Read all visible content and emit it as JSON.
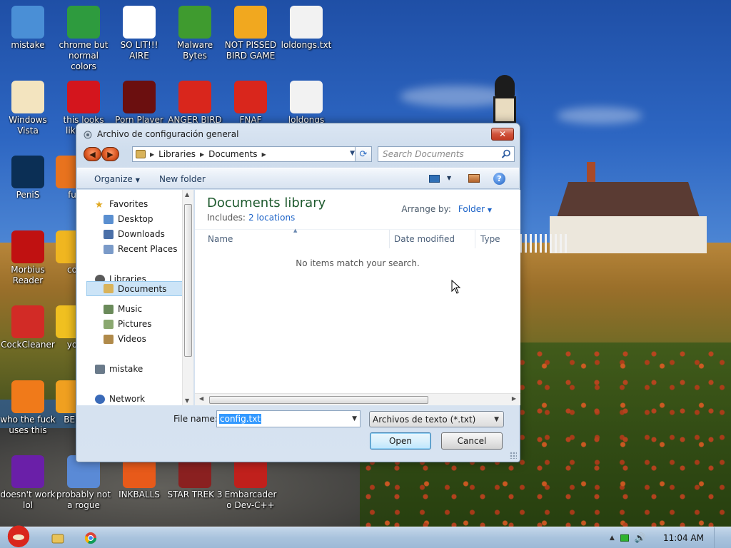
{
  "desktop": {
    "icons": [
      {
        "label": "mistake",
        "icon": "computer-icon",
        "color": "#4a8fd6"
      },
      {
        "label": "chrome but normal colors",
        "icon": "chrome-icon",
        "color": "#2e9b3e"
      },
      {
        "label": "SO LIT!!! AIRE",
        "icon": "cards-icon",
        "color": "#ffffff"
      },
      {
        "label": "Malware Bytes",
        "icon": "shield-icon",
        "color": "#3f9b2f"
      },
      {
        "label": "NOT PISSED BIRD GAME",
        "icon": "green-pig-icon",
        "color": "#f1a81f"
      },
      {
        "label": "loldongs.txt",
        "icon": "text-file-icon",
        "color": "#f2f2f2"
      },
      {
        "label": "Windows Vista",
        "icon": "egg-icon",
        "color": "#f3e4bf"
      },
      {
        "label": "this looks like a va",
        "icon": "opera-icon",
        "color": "#d4151d"
      },
      {
        "label": "Porn Player",
        "icon": "flash-icon",
        "color": "#6b0f0f"
      },
      {
        "label": "ANGER BIRD",
        "icon": "red-bird-icon",
        "color": "#d9261c"
      },
      {
        "label": "FNAF",
        "icon": "red-bird-icon",
        "color": "#d9261c"
      },
      {
        "label": "loldongs",
        "icon": "text-file-icon",
        "color": "#f2f2f2"
      },
      {
        "label": "PeniS",
        "icon": "photoshop-icon",
        "color": "#0b2f55"
      },
      {
        "label": "fu",
        "icon": "firefox-icon",
        "color": "#e8731e"
      },
      {
        "label": "Morbius Reader",
        "icon": "pdf-icon",
        "color": "#c01111"
      },
      {
        "label": "co",
        "icon": "yellow-icon",
        "color": "#f0b620"
      },
      {
        "label": "CockCleaner",
        "icon": "ccleaner-icon",
        "color": "#d22b26"
      },
      {
        "label": "yo",
        "icon": "star-icon",
        "color": "#f0c020"
      },
      {
        "label": "who the fuck uses this",
        "icon": "lightning-icon",
        "color": "#f07a1a"
      },
      {
        "label": "BEE",
        "icon": "bee-icon",
        "color": "#f0a020"
      },
      {
        "label": "doesn't work lol",
        "icon": "yahoo-icon",
        "color": "#6a1fa8"
      },
      {
        "label": "probably not a rogue",
        "icon": "gears-icon",
        "color": "#5a8ad6"
      },
      {
        "label": "INKBALLS",
        "icon": "ball-icon",
        "color": "#e85a1a"
      },
      {
        "label": "STAR TREK 3",
        "icon": "starwars-icon",
        "color": "#8a2020"
      },
      {
        "label": "Embarcadero Dev-C++",
        "icon": "devcpp-icon",
        "color": "#c0201c"
      }
    ]
  },
  "dialog": {
    "title": "Archivo de configuración general",
    "close_label": "✕",
    "address": {
      "segments": [
        "Libraries",
        "Documents"
      ],
      "separator": "▶"
    },
    "search_placeholder": "Search Documents",
    "toolbar": {
      "organize": "Organize",
      "new_folder": "New folder",
      "help": "?"
    },
    "nav": {
      "favorites": "Favorites",
      "desktop": "Desktop",
      "downloads": "Downloads",
      "recent_places": "Recent Places",
      "libraries": "Libraries",
      "documents": "Documents",
      "music": "Music",
      "pictures": "Pictures",
      "videos": "Videos",
      "homegroup": "mistake",
      "network": "Network"
    },
    "content": {
      "library_title": "Documents library",
      "includes_label": "Includes:",
      "locations_link": "2 locations",
      "arrange_by_label": "Arrange by:",
      "arrange_by_value": "Folder",
      "columns": [
        "Name",
        "Date modified",
        "Type"
      ],
      "empty_message": "No items match your search."
    },
    "file_name_label": "File name:",
    "file_name_value": "config.txt",
    "file_type_value": "Archivos de texto (*.txt)",
    "open_label": "Open",
    "cancel_label": "Cancel"
  },
  "taskbar": {
    "clock": "11:04 AM"
  }
}
